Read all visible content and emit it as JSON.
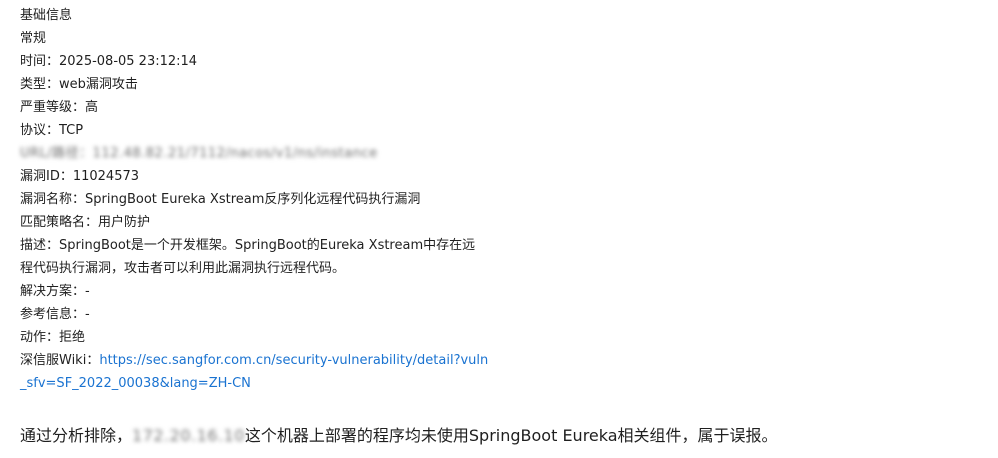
{
  "section_title": "基础信息",
  "section_subtitle": "常规",
  "fields": {
    "time": "时间：2025-08-05 23:12:14",
    "type": "类型：web漏洞攻击",
    "severity": "严重等级：高",
    "protocol": "协议：TCP",
    "url": "URL/路径：112.48.82.21/7112/nacos/v1/ns/instance",
    "vuln_id": "漏洞ID：11024573",
    "vuln_name": "漏洞名称：SpringBoot Eureka Xstream反序列化远程代码执行漏洞",
    "policy": "匹配策略名：用户防护",
    "description_line1": "描述：SpringBoot是一个开发框架。SpringBoot的Eureka Xstream中存在远",
    "description_line2": "程代码执行漏洞，攻击者可以利用此漏洞执行远程代码。",
    "solution": "解决方案：-",
    "reference": "参考信息：-",
    "action": "动作：拒绝",
    "wiki_label": "深信服Wiki：",
    "wiki_url_line1": "https://sec.sangfor.com.cn/security-vulnerability/detail?vuln",
    "wiki_url_line2": "_sfv=SF_2022_00038&lang=ZH-CN"
  },
  "conclusion": {
    "prefix": "通过分析排除，",
    "redacted_ip": "172.20.16.10",
    "suffix": "这个机器上部署的程序均未使用SpringBoot Eureka相关组件，属于误报。"
  },
  "colors": {
    "text": "#1f1f1f",
    "link": "#1a73d1",
    "background": "#ffffff"
  }
}
